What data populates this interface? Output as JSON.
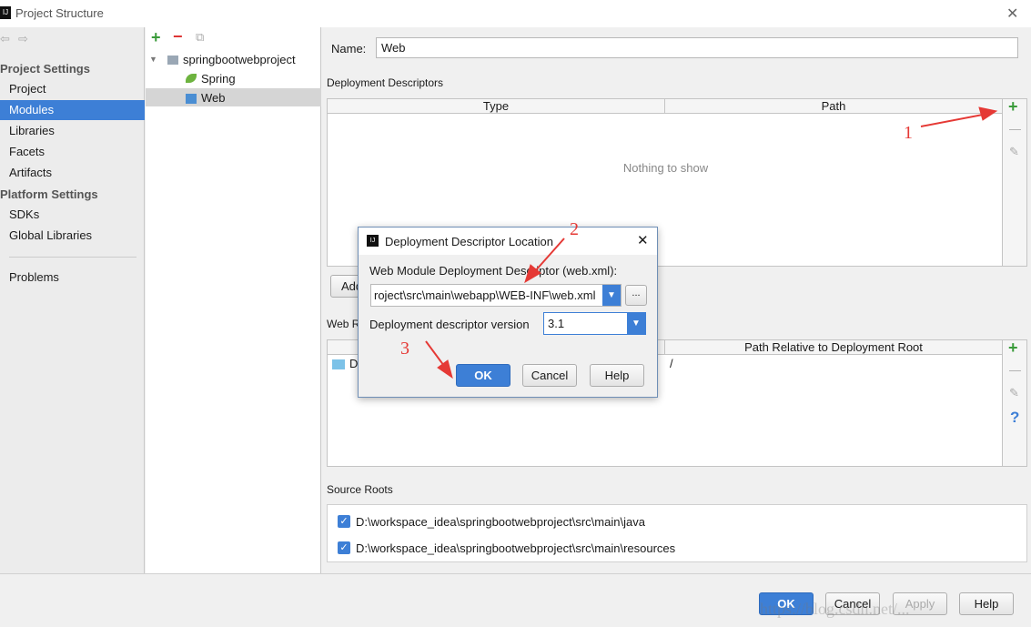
{
  "window": {
    "title": "Project Structure",
    "close": "✕"
  },
  "sidebar": {
    "project_settings": "Project Settings",
    "items": [
      "Project",
      "Modules",
      "Libraries",
      "Facets",
      "Artifacts"
    ],
    "platform_settings": "Platform Settings",
    "platform_items": [
      "SDKs",
      "Global Libraries"
    ],
    "problems": "Problems",
    "selected": "Modules"
  },
  "tree": {
    "root": "springbootwebproject",
    "children": [
      "Spring",
      "Web"
    ],
    "selected": "Web"
  },
  "main": {
    "name_label": "Name:",
    "name_value": "Web",
    "deployment_descriptors": "Deployment Descriptors",
    "dd_columns": [
      "Type",
      "Path"
    ],
    "empty": "Nothing to show",
    "add_button": "Add",
    "web_resource_label": "Web R",
    "wr_columns": [
      "",
      "Path Relative to Deployment Root"
    ],
    "wr_row": {
      "dir": "D",
      "path": "/"
    },
    "source_roots": "Source Roots",
    "roots": [
      "D:\\workspace_idea\\springbootwebproject\\src\\main\\java",
      "D:\\workspace_idea\\springbootwebproject\\src\\main\\resources"
    ],
    "help_icon": "?"
  },
  "dialog": {
    "title": "Deployment Descriptor Location",
    "location_label": "Web Module Deployment Descriptor (web.xml):",
    "location_value": "roject\\src\\main\\webapp\\WEB-INF\\web.xml",
    "browse": "...",
    "version_label": "Deployment descriptor version",
    "version_value": "3.1",
    "ok": "OK",
    "cancel": "Cancel",
    "help": "Help"
  },
  "footer": {
    "ok": "OK",
    "cancel": "Cancel",
    "apply": "Apply",
    "help": "Help",
    "watermark": "https://blog.csdn.net/..."
  },
  "annotations": [
    "1",
    "2",
    "3"
  ],
  "colors": {
    "accent": "#3d7fd6",
    "annotation": "#e53935",
    "selection": "#3d7fd6"
  }
}
